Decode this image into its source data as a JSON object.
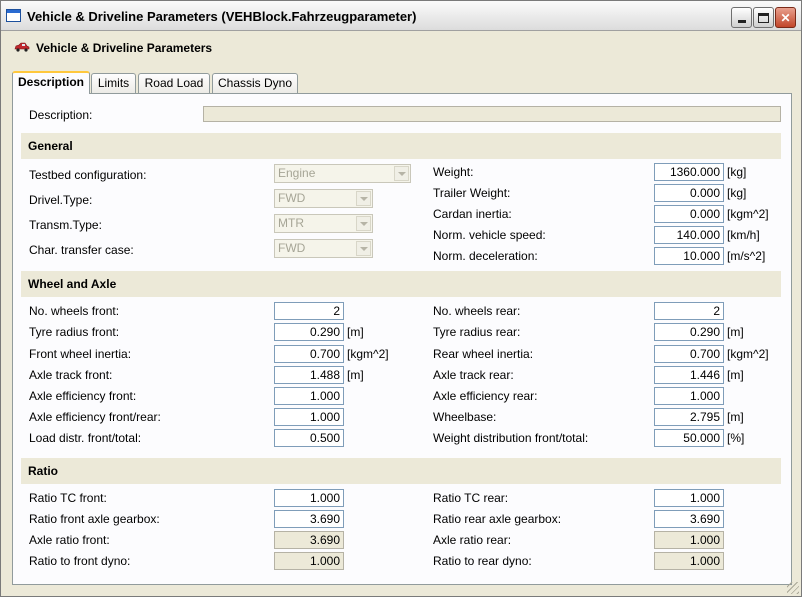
{
  "window": {
    "title": "Vehicle & Driveline Parameters (VEHBlock.Fahrzeugparameter)",
    "buttons": [
      "minimize",
      "maximize",
      "close"
    ]
  },
  "header": {
    "title": "Vehicle & Driveline Parameters",
    "icon": "car-icon"
  },
  "tabs": [
    {
      "label": "Description",
      "active": true
    },
    {
      "label": "Limits",
      "active": false
    },
    {
      "label": "Road Load",
      "active": false
    },
    {
      "label": "Chassis Dyno",
      "active": false
    }
  ],
  "description": {
    "label": "Description:",
    "value": ""
  },
  "general": {
    "title": "General",
    "testbed_configuration": {
      "label": "Testbed configuration:",
      "value": "Engine"
    },
    "drivel_type": {
      "label": "Drivel.Type:",
      "value": "FWD"
    },
    "transm_type": {
      "label": "Transm.Type:",
      "value": "MTR"
    },
    "char_transfer_case": {
      "label": "Char. transfer case:",
      "value": "FWD"
    },
    "weight": {
      "label": "Weight:",
      "value": "1360.000",
      "unit": "[kg]"
    },
    "trailer_weight": {
      "label": "Trailer Weight:",
      "value": "0.000",
      "unit": "[kg]"
    },
    "cardan_inertia": {
      "label": "Cardan inertia:",
      "value": "0.000",
      "unit": "[kgm^2]"
    },
    "norm_vehicle_speed": {
      "label": "Norm. vehicle speed:",
      "value": "140.000",
      "unit": "[km/h]"
    },
    "norm_deceleration": {
      "label": "Norm. deceleration:",
      "value": "10.000",
      "unit": "[m/s^2]"
    }
  },
  "wheel_axle": {
    "title": "Wheel and Axle",
    "no_wheels_front": {
      "label": "No. wheels front:",
      "value": "2"
    },
    "tyre_radius_front": {
      "label": "Tyre radius front:",
      "value": "0.290",
      "unit": "[m]"
    },
    "front_wheel_inertia": {
      "label": "Front wheel inertia:",
      "value": "0.700",
      "unit": "[kgm^2]"
    },
    "axle_track_front": {
      "label": "Axle track front:",
      "value": "1.488",
      "unit": "[m]"
    },
    "axle_efficiency_front": {
      "label": "Axle efficiency front:",
      "value": "1.000"
    },
    "axle_efficiency_front_rear": {
      "label": "Axle efficiency front/rear:",
      "value": "1.000"
    },
    "load_distr_front_total": {
      "label": "Load distr. front/total:",
      "value": "0.500"
    },
    "no_wheels_rear": {
      "label": "No. wheels rear:",
      "value": "2"
    },
    "tyre_radius_rear": {
      "label": "Tyre radius rear:",
      "value": "0.290",
      "unit": "[m]"
    },
    "rear_wheel_inertia": {
      "label": "Rear wheel inertia:",
      "value": "0.700",
      "unit": "[kgm^2]"
    },
    "axle_track_rear": {
      "label": "Axle track rear:",
      "value": "1.446",
      "unit": "[m]"
    },
    "axle_efficiency_rear": {
      "label": "Axle efficiency rear:",
      "value": "1.000"
    },
    "wheelbase": {
      "label": "Wheelbase:",
      "value": "2.795",
      "unit": "[m]"
    },
    "weight_distribution": {
      "label": "Weight distribution front/total:",
      "value": "50.000",
      "unit": "[%]"
    }
  },
  "ratio": {
    "title": "Ratio",
    "ratio_tc_front": {
      "label": "Ratio TC front:",
      "value": "1.000"
    },
    "ratio_front_axle_gearbox": {
      "label": "Ratio front axle gearbox:",
      "value": "3.690"
    },
    "axle_ratio_front": {
      "label": "Axle ratio front:",
      "value": "3.690"
    },
    "ratio_to_front_dyno": {
      "label": "Ratio to front dyno:",
      "value": "1.000"
    },
    "ratio_tc_rear": {
      "label": "Ratio TC rear:",
      "value": "1.000"
    },
    "ratio_rear_axle_gearbox": {
      "label": "Ratio rear axle gearbox:",
      "value": "3.690"
    },
    "axle_ratio_rear": {
      "label": "Axle ratio rear:",
      "value": "1.000"
    },
    "ratio_to_rear_dyno": {
      "label": "Ratio to rear dyno:",
      "value": "1.000"
    }
  }
}
